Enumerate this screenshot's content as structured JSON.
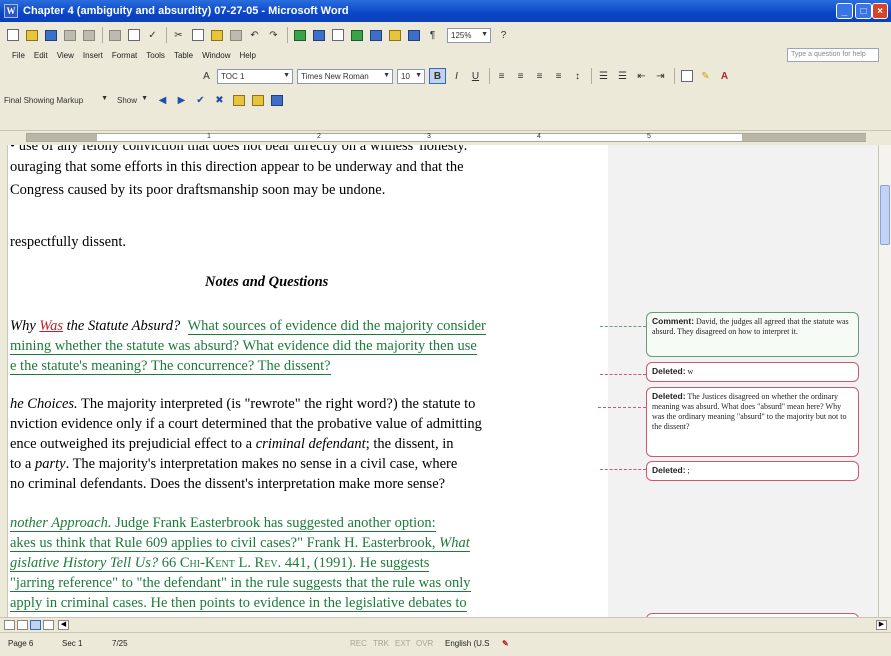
{
  "window": {
    "title": "Chapter 4 (ambiguity and absurdity) 07-27-05 - Microsoft Word",
    "app_icon": "word-icon",
    "buttons": [
      "minimize-icon",
      "maximize-icon",
      "close-icon"
    ]
  },
  "menu": {
    "items": [
      "File",
      "Edit",
      "View",
      "Insert",
      "Format",
      "Tools",
      "Table",
      "Window",
      "Help"
    ],
    "ask_placeholder": "Type a question for help"
  },
  "standard_toolbar": {
    "zoom": "125%"
  },
  "formatting_toolbar": {
    "style": "TOC 1",
    "font": "Times New Roman",
    "size": "10",
    "bold": "B",
    "italic": "I",
    "underline": "U"
  },
  "reviewing_toolbar": {
    "display": "Final Showing Markup",
    "show": "Show"
  },
  "ruler": {
    "numbers": [
      "1",
      "2",
      "3",
      "4",
      "5"
    ]
  },
  "document": {
    "line0": "• use of any felony conviction that does not bear directly on a witness' honesty.",
    "line1": "ouraging that some efforts in this direction appear to be underway and that the",
    "line2": "Congress caused by its poor draftsmanship soon may be undone.",
    "line3": "respectfully dissent.",
    "heading": "Notes and Questions",
    "q1_prefix": "Why ",
    "q1_was": "Was",
    "q1_rest": " the Statute Absurd?",
    "q1_ins1": "What sources of evidence did the majority consider",
    "q1_ins2": "mining whether the statute was absurd?  What evidence did the majority then use",
    "q1_ins3": "e the statute's meaning?  The concurrence?  The dissent?",
    "q2_lead": "he Choices.",
    "q2_l1_rest": "  The majority interpreted (is \"rewrote\" the right word?) the statute to",
    "q2_l2": "nviction evidence only if a court determined that the probative value of admitting",
    "q2_l3a": "ence outweighed its prejudicial effect to a ",
    "q2_l3_ital": "criminal defendant",
    "q2_l3b": ";  the dissent, in",
    "q2_l4a": " to a ",
    "q2_l4_ital": "party",
    "q2_l4b": ".  The majority's interpretation makes no sense in a civil case, where",
    "q2_l5": " no criminal defendants.  Does the dissent's interpretation make more sense?",
    "q3_l1a": "nother Approach.",
    "q3_l1b": "  Judge Frank Easterbrook has suggested another option:",
    "q3_l2a": "akes us think that Rule 609 applies to civil cases?\"  Frank H. Easterbrook, ",
    "q3_l2_ital": "What",
    "q3_l3_ital": "gislative History Tell Us?",
    "q3_l3b": " 66 ",
    "q3_l3_sc": "Chi-Kent L. Rev.",
    "q3_l3c": " 441,        (1991).  He suggests",
    "q3_l4": "\"jarring reference\" to \"the defendant\" in the rule suggests that the rule was only",
    "q3_l5": " apply in criminal cases.  He then points to evidence in the legislative debates to"
  },
  "balloons": {
    "c1_label": "Comment:",
    "c1_text": "David, the judges all agreed that the statute was absurd.  They disagreed on how to interpret it.",
    "d1_label": "Deleted:",
    "d1_text": "w",
    "d2_label": "Deleted:",
    "d2_text": "The Justices disagreed on whether the ordinary meaning was absurd.  What does \"absurd\" mean here? Why was the ordinary meaning \"absurd\" to the majority but not to the dissent?",
    "d3_label": "Deleted:",
    "d3_text": ";"
  },
  "status": {
    "page": "Page 6",
    "sec": "Sec 1",
    "of": "7/25",
    "rec": "REC",
    "trk": "TRK",
    "ext": "EXT",
    "ovr": "OVR",
    "language": "English (U.S"
  }
}
